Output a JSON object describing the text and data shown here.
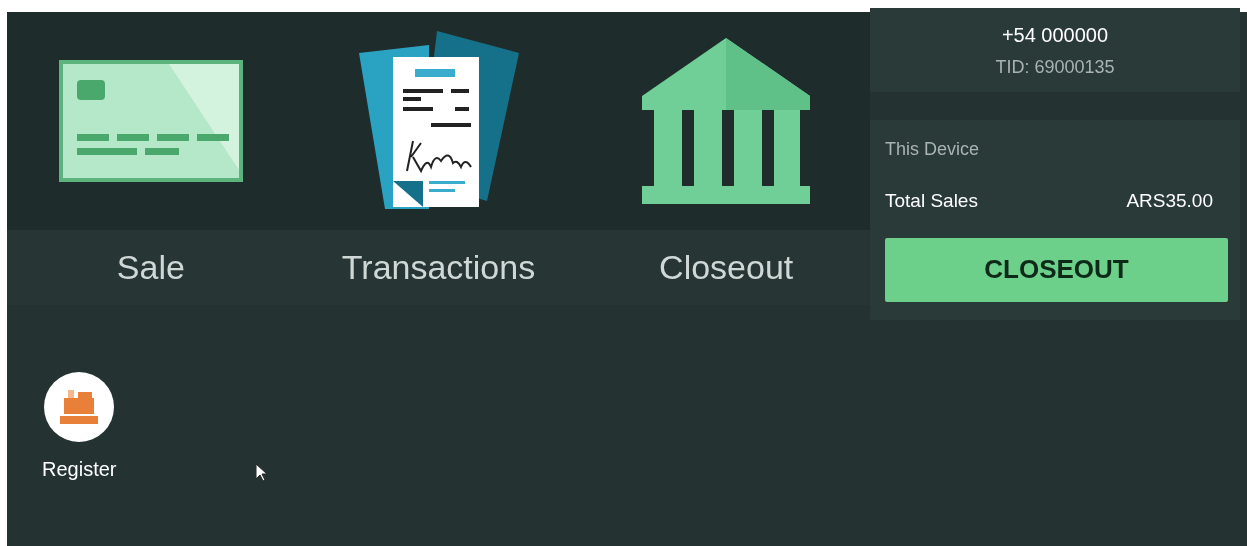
{
  "tiles": [
    {
      "label": "Sale",
      "kind": "card"
    },
    {
      "label": "Transactions",
      "kind": "receipt"
    },
    {
      "label": "Closeout",
      "kind": "bank"
    }
  ],
  "account": {
    "phone": "+54 000000",
    "tid": "TID: 69000135"
  },
  "device": {
    "heading": "This Device",
    "total_label": "Total Sales",
    "total_value": "ARS35.00",
    "button": "CLOSEOUT"
  },
  "apps": [
    {
      "label": "Register"
    }
  ]
}
